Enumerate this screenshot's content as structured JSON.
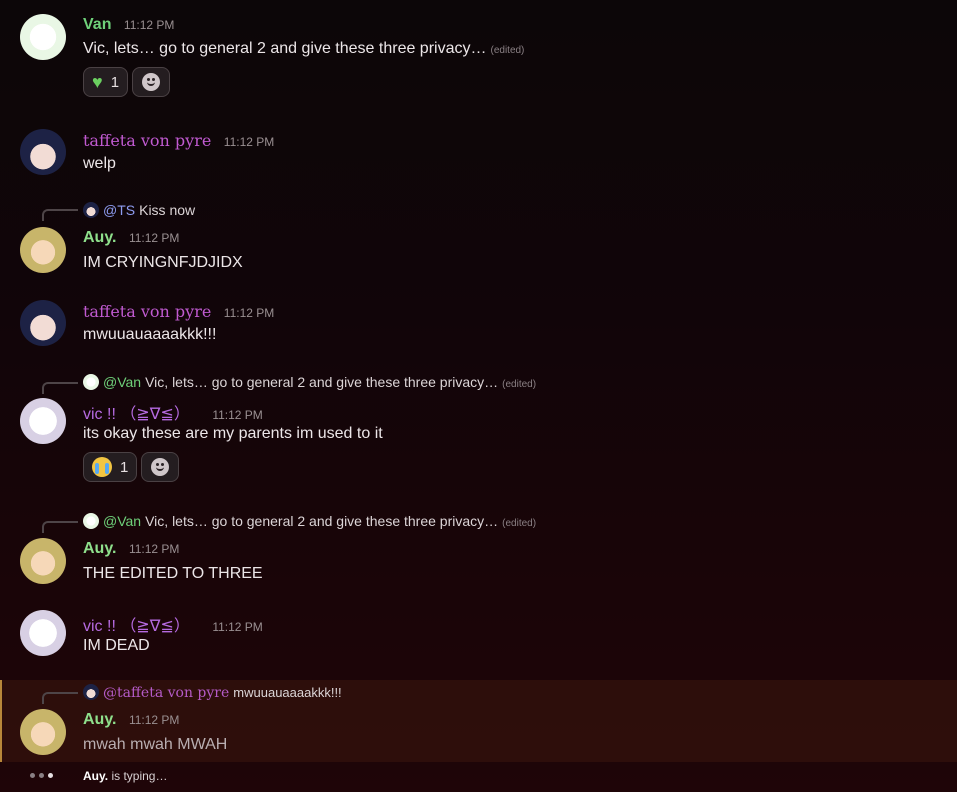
{
  "messages": [
    {
      "author": "Van",
      "time": "11:12 PM",
      "text": "Vic, lets… go to general 2 and give these three privacy…",
      "edited": "(edited)",
      "reactions": [
        {
          "emoji": "green-heart",
          "count": "1"
        }
      ]
    },
    {
      "author": "taffeta von pyre",
      "time": "11:12 PM",
      "text": "welp"
    },
    {
      "reply": {
        "mention": "@TS",
        "text": "Kiss now"
      },
      "author": "Auy.",
      "time": "11:12 PM",
      "text": "IM CRYINGNFJDJIDX"
    },
    {
      "author": "taffeta von pyre",
      "time": "11:12 PM",
      "text": "mwuuauaaaakkk!!!"
    },
    {
      "reply": {
        "mention": "@Van",
        "text": "Vic, lets… go to general 2 and give these three privacy…",
        "edited": "(edited)"
      },
      "author": "vic !! （≧∇≦）",
      "time": "11:12 PM",
      "text": "its okay these are my parents im used to it",
      "reactions": [
        {
          "emoji": "loudly-crying-face",
          "count": "1"
        }
      ]
    },
    {
      "reply": {
        "mention": "@Van",
        "text": "Vic, lets… go to general 2 and give these three privacy…",
        "edited": "(edited)"
      },
      "author": "Auy.",
      "time": "11:12 PM",
      "text": "THE EDITED TO THREE"
    },
    {
      "author": "vic !! （≧∇≦）",
      "time": "11:12 PM",
      "text": "IM DEAD"
    },
    {
      "reply": {
        "mention": "@taffeta von pyre",
        "text": "mwuuauaaaakkk!!!"
      },
      "author": "Auy.",
      "time": "11:12 PM",
      "text": "mwah mwah MWAH"
    }
  ],
  "typing": {
    "user": "Auy.",
    "suffix": " is typing…"
  },
  "colors": {
    "van": "#6fd17a",
    "auy": "#8fe08c",
    "taffeta": "#c05ad0",
    "vic": "#b56ae0",
    "highlight_bar": "#b8873a"
  }
}
